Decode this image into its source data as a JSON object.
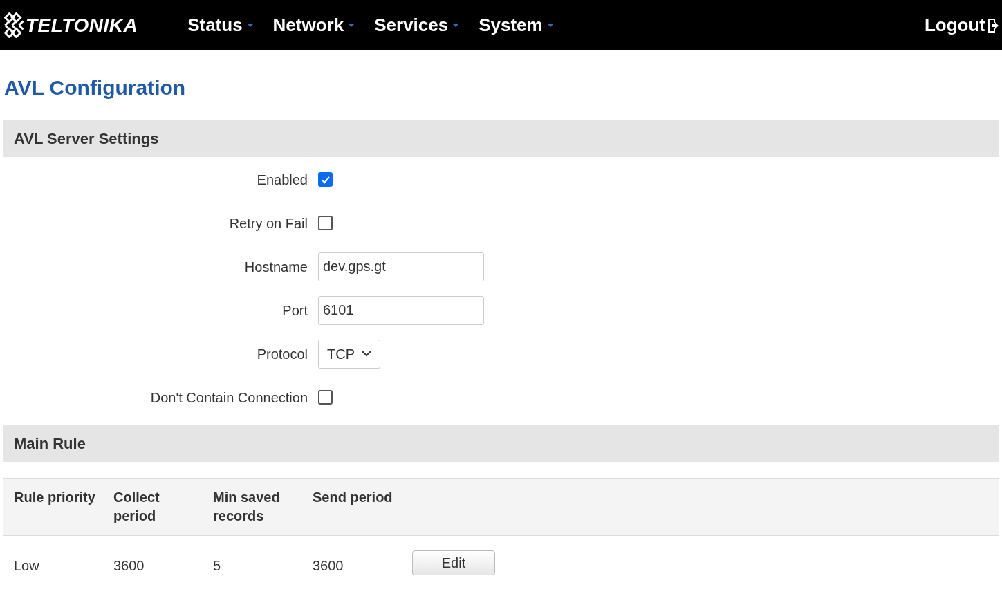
{
  "header": {
    "logo": "TELTONIKA",
    "menu": [
      {
        "label": "Status"
      },
      {
        "label": "Network"
      },
      {
        "label": "Services"
      },
      {
        "label": "System"
      }
    ],
    "logout": "Logout"
  },
  "page_title": "AVL Configuration",
  "server_settings": {
    "title": "AVL Server Settings",
    "fields": [
      {
        "kind": "checkbox",
        "label": "Enabled",
        "checked": true
      },
      {
        "kind": "checkbox",
        "label": "Retry on Fail",
        "checked": false
      },
      {
        "kind": "text",
        "label": "Hostname",
        "value": "dev.gps.gt"
      },
      {
        "kind": "text",
        "label": "Port",
        "value": "6101"
      },
      {
        "kind": "select",
        "label": "Protocol",
        "value": "TCP"
      },
      {
        "kind": "checkbox",
        "label": "Don't Contain Connection",
        "checked": false
      }
    ]
  },
  "main_rule": {
    "title": "Main Rule",
    "columns": [
      "Rule priority",
      "Collect period",
      "Min saved records",
      "Send period"
    ],
    "rows": [
      {
        "cells": [
          "Low",
          "3600",
          "5",
          "3600"
        ],
        "button": "Edit"
      }
    ]
  }
}
